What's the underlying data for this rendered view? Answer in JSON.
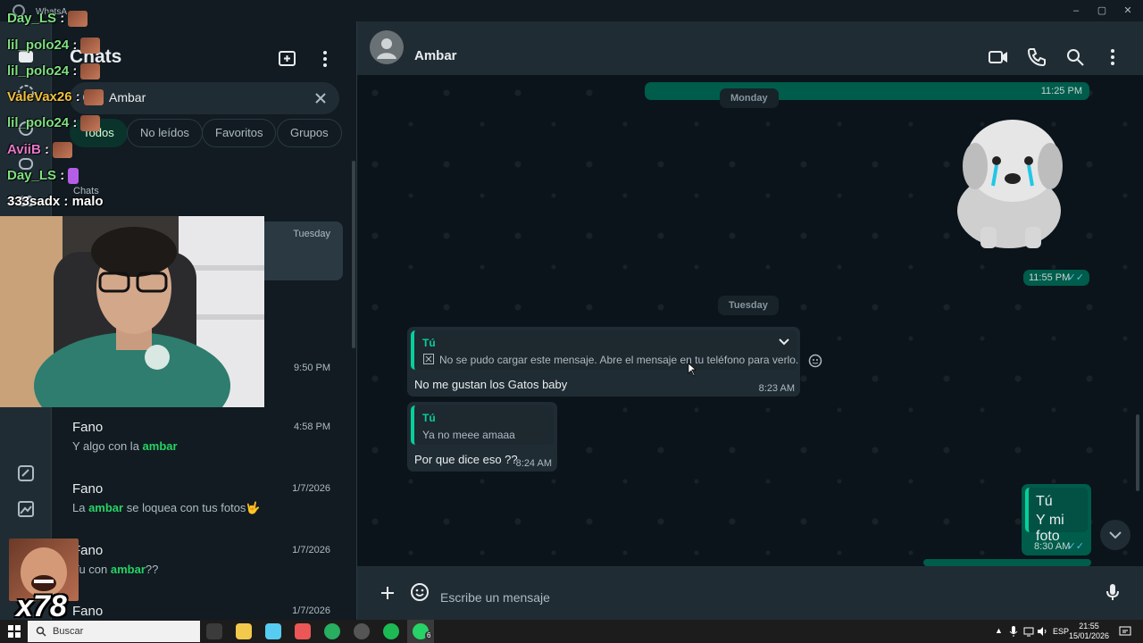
{
  "window": {
    "title": "WhatsA",
    "controls": [
      "–",
      "▢",
      "✕"
    ]
  },
  "list": {
    "title": "Chats",
    "search_value": "Ambar",
    "filters": [
      "Todos",
      "No leídos",
      "Favoritos",
      "Grupos"
    ],
    "rail_label": "Chats",
    "chats": [
      {
        "name": "",
        "time": "Tuesday",
        "preview": ""
      },
      {
        "name": "",
        "time": "9:50 PM",
        "preview": ""
      },
      {
        "name": "Fano",
        "time": "4:58 PM",
        "preview_before": "Y algo con la ",
        "preview_bold": "ambar",
        "preview_after": ""
      },
      {
        "name": "Fano",
        "time": "1/7/2026",
        "preview_before": "La ",
        "preview_bold": "ambar",
        "preview_after": " se loquea con tus fotos🤟"
      },
      {
        "name": "Fano",
        "time": "1/7/2026",
        "preview_before": "Tu con ",
        "preview_bold": "ambar",
        "preview_after": "??"
      },
      {
        "name": "Fano",
        "time": "1/7/2026",
        "preview": ""
      }
    ]
  },
  "chat": {
    "contact": "Ambar",
    "messages": {
      "top_time": "11:25 PM",
      "day1": "Monday",
      "sticker_time": "11:55 PM",
      "day2": "Tuesday",
      "m1_quote_name": "Tú",
      "m1_quote_text": "No se pudo cargar este mensaje. Abre el mensaje en tu teléfono para verlo.",
      "m1_text": "No me gustan los Gatos baby",
      "m1_time": "8:23 AM",
      "m2_quote_name": "Tú",
      "m2_quote_text": "Ya no meee amaaa",
      "m2_text": "Por que dice eso ??",
      "m2_time": "8:24 AM",
      "m3_quote_name": "Tú",
      "m3_quote_text": "Y mi foto",
      "m3_time": "8:30 AM"
    },
    "composer_placeholder": "Escribe un mensaje"
  },
  "stream_chat": [
    {
      "user": "Day_LS",
      "color": "#7ee081",
      "msg": "",
      "emote": true
    },
    {
      "user": "lil_polo24",
      "color": "#7ee081",
      "msg": "",
      "emote": true
    },
    {
      "user": "lil_polo24",
      "color": "#7ee081",
      "msg": "",
      "emote": true
    },
    {
      "user": "ValeVax26",
      "color": "#f0c040",
      "msg": "",
      "emote": true
    },
    {
      "user": "lil_polo24",
      "color": "#7ee081",
      "msg": "",
      "emote": true
    },
    {
      "user": "AviiB",
      "color": "#e678c8",
      "msg": "",
      "emote": true
    },
    {
      "user": "Day_LS",
      "color": "#7ee081",
      "msg": "",
      "emote": true
    },
    {
      "user": "333sadx",
      "color": "#ffffff",
      "msg": "malo",
      "emote": false
    }
  ],
  "overlay": {
    "emote_count": "x78"
  },
  "taskbar": {
    "search": "Buscar",
    "lang": "ESP",
    "time": "21:55",
    "date": "15/01/2026",
    "wa_badge": "6"
  }
}
